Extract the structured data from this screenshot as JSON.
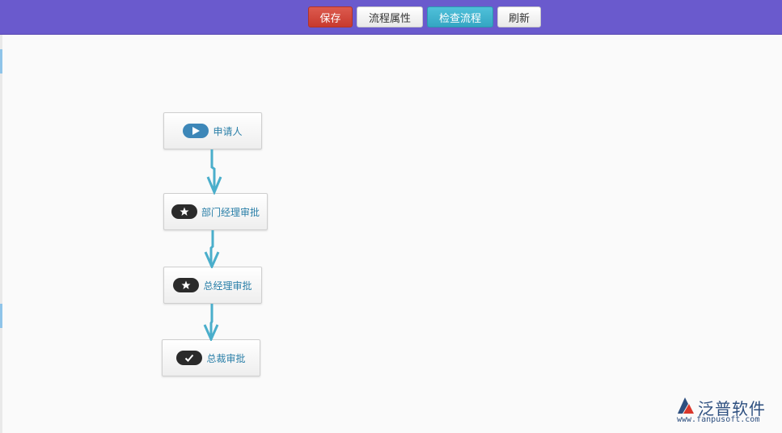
{
  "toolbar": {
    "save_label": "保存",
    "properties_label": "流程属性",
    "check_label": "检查流程",
    "refresh_label": "刷新"
  },
  "flow": {
    "nodes": [
      {
        "label": "申请人",
        "icon": "play-icon",
        "kind": "start"
      },
      {
        "label": "部门经理审批",
        "icon": "star-icon",
        "kind": "task"
      },
      {
        "label": "总经理审批",
        "icon": "star-icon",
        "kind": "task"
      },
      {
        "label": "总裁审批",
        "icon": "check-icon",
        "kind": "end"
      }
    ]
  },
  "logo": {
    "text": "泛普软件",
    "url": "www.fanpusoft.com"
  },
  "colors": {
    "toolbar_bg": "#6a5acd",
    "save_button": "#c83a2e",
    "check_button": "#34a6c3",
    "arrow": "#4aaecb",
    "node_text": "#2a7fa8"
  }
}
